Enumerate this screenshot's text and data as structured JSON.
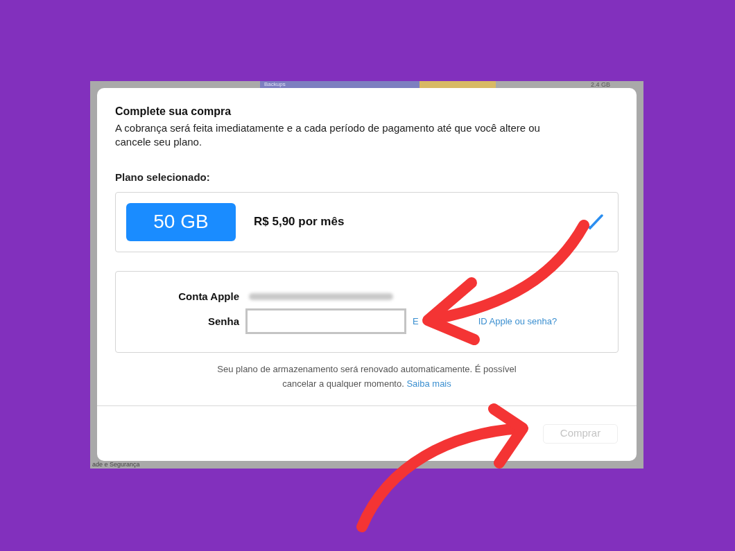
{
  "background_app": {
    "bar_label": "Backups",
    "size": "2.4 GB",
    "bottom_label": "ade e Segurança"
  },
  "dialog": {
    "title": "Complete sua compra",
    "description": "A cobrança será feita imediatamente e a cada período de pagamento até que você altere ou cancele seu plano.",
    "plan_heading": "Plano selecionado:",
    "plan": {
      "badge": "50 GB",
      "price": "R$ 5,90 por mês",
      "selected": true
    },
    "account": {
      "label": "Conta Apple",
      "password_label": "Senha",
      "forgot_link_start": "E",
      "forgot_link_end": "ID Apple ou senha?"
    },
    "notice": "Seu plano de armazenamento será renovado automaticamente. É possível cancelar a qualquer momento.",
    "notice_link": "Saiba mais",
    "buy_button": {
      "label": "Comprar",
      "disabled": true
    }
  }
}
